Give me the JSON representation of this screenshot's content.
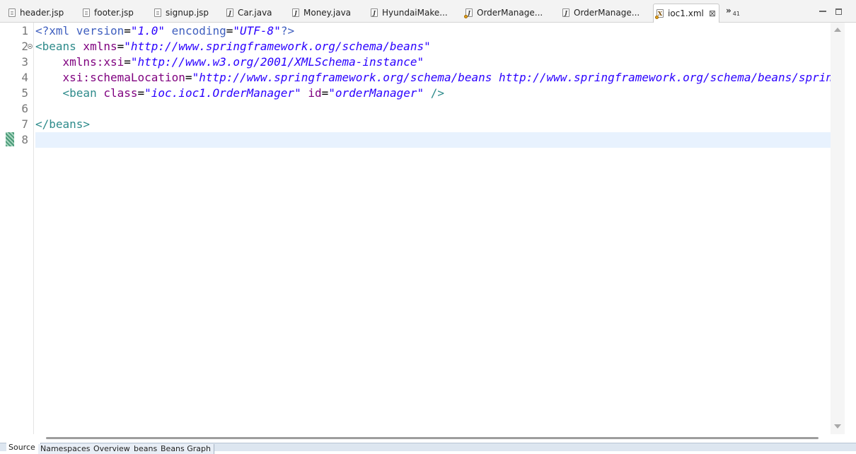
{
  "tabs": [
    {
      "label": "header.jsp",
      "icon": "jsp-file-icon"
    },
    {
      "label": "footer.jsp",
      "icon": "jsp-file-icon"
    },
    {
      "label": "signup.jsp",
      "icon": "jsp-file-icon"
    },
    {
      "label": "Car.java",
      "icon": "java-file-icon"
    },
    {
      "label": "Money.java",
      "icon": "java-file-icon"
    },
    {
      "label": "HyundaiMake...",
      "icon": "java-file-icon"
    },
    {
      "label": "OrderManage...",
      "icon": "java-file-icon"
    },
    {
      "label": "OrderManage...",
      "icon": "java-file-icon"
    },
    {
      "label": "ioc1.xml",
      "icon": "xml-file-icon",
      "active": true,
      "close": "⊠"
    }
  ],
  "overflow": {
    "glyph": "»",
    "count": "41"
  },
  "editor": {
    "line_numbers": [
      "1",
      "2",
      "3",
      "4",
      "5",
      "6",
      "7",
      "8"
    ],
    "current_line": 8,
    "lines": [
      [
        {
          "t": "<?xml version",
          "c": "pi"
        },
        {
          "t": "=",
          "c": "eq"
        },
        {
          "t": "\"1.0\"",
          "c": "av"
        },
        {
          "t": " encoding",
          "c": "pi"
        },
        {
          "t": "=",
          "c": "eq"
        },
        {
          "t": "\"UTF-8\"",
          "c": "av"
        },
        {
          "t": "?>",
          "c": "pi"
        }
      ],
      [
        {
          "t": "<beans",
          "c": "tg"
        },
        {
          "t": " xmlns",
          "c": "an"
        },
        {
          "t": "=",
          "c": "eq"
        },
        {
          "t": "\"http://www.springframework.org/schema/beans\"",
          "c": "av"
        }
      ],
      [
        {
          "t": "    xmlns:xsi",
          "c": "an"
        },
        {
          "t": "=",
          "c": "eq"
        },
        {
          "t": "\"http://www.w3.org/2001/XMLSchema-instance\"",
          "c": "av"
        }
      ],
      [
        {
          "t": "    xsi:schemaLocation",
          "c": "an"
        },
        {
          "t": "=",
          "c": "eq"
        },
        {
          "t": "\"http://www.springframework.org/schema/beans http://www.springframework.org/schema/beans/spring-beans.",
          "c": "av"
        }
      ],
      [
        {
          "t": "    <bean",
          "c": "tg"
        },
        {
          "t": " class",
          "c": "an"
        },
        {
          "t": "=",
          "c": "eq"
        },
        {
          "t": "\"ioc.ioc1.OrderManager\"",
          "c": "av"
        },
        {
          "t": " id",
          "c": "an"
        },
        {
          "t": "=",
          "c": "eq"
        },
        {
          "t": "\"orderManager\"",
          "c": "av"
        },
        {
          "t": " />",
          "c": "tg"
        }
      ],
      [],
      [
        {
          "t": "</beans>",
          "c": "tg"
        }
      ],
      []
    ]
  },
  "bottom_tabs": [
    "Source",
    "Namespaces",
    "Overview",
    "beans",
    "Beans Graph"
  ],
  "colors": {
    "tag": "#2e8b8b",
    "attribute_name": "#7f007f",
    "attribute_value": "#2a00ff",
    "processing_instruction": "#3f5fbf",
    "current_line": "#e8f2fe"
  }
}
